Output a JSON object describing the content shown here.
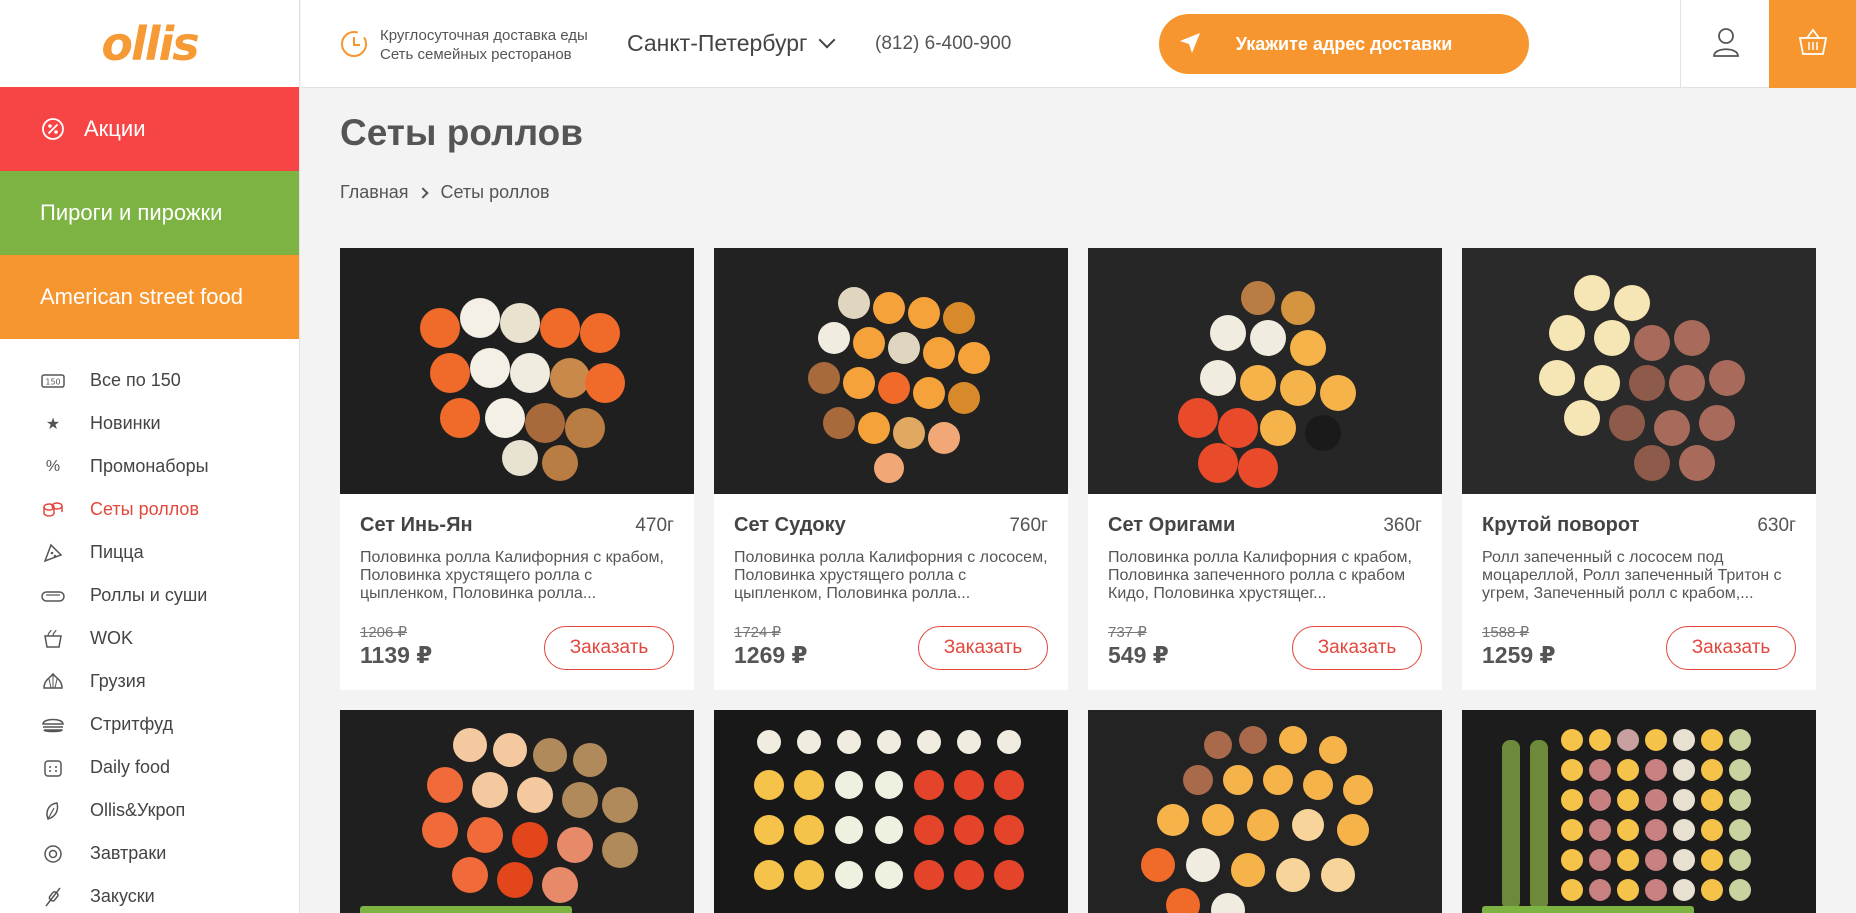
{
  "logo": "ollis",
  "promo_categories": [
    {
      "label": "Акции",
      "color": "#f74545",
      "icon": "percent-badge-icon"
    },
    {
      "label": "Пироги и пирожки",
      "color": "#7cb342"
    },
    {
      "label": "American street food",
      "color": "#f7962f"
    }
  ],
  "menu": [
    {
      "label": "Все по 150",
      "icon": "150-badge-icon",
      "active": false
    },
    {
      "label": "Новинки",
      "icon": "star-icon",
      "active": false
    },
    {
      "label": "Промонаборы",
      "icon": "percent-icon",
      "active": false
    },
    {
      "label": "Сеты роллов",
      "icon": "rolls-set-icon",
      "active": true
    },
    {
      "label": "Пицца",
      "icon": "pizza-icon",
      "active": false
    },
    {
      "label": "Роллы и суши",
      "icon": "sushi-icon",
      "active": false
    },
    {
      "label": "WOK",
      "icon": "wok-icon",
      "active": false
    },
    {
      "label": "Грузия",
      "icon": "khinkali-icon",
      "active": false
    },
    {
      "label": "Стритфуд",
      "icon": "burger-icon",
      "active": false
    },
    {
      "label": "Daily food",
      "icon": "calendar-icon",
      "active": false
    },
    {
      "label": "Ollis&Укроп",
      "icon": "leaf-icon",
      "active": false
    },
    {
      "label": "Завтраки",
      "icon": "egg-icon",
      "active": false
    },
    {
      "label": "Закуски",
      "icon": "skewer-icon",
      "active": false
    }
  ],
  "header": {
    "tagline_1": "Круглосуточная доставка еды",
    "tagline_2": "Сеть семейных ресторанов",
    "city": "Санкт-Петербург",
    "phone": "(812) 6-400-900",
    "address_button": "Укажите адрес доставки"
  },
  "page": {
    "title": "Сеты роллов",
    "breadcrumbs": [
      "Главная",
      "Сеты роллов"
    ]
  },
  "order_label": "Заказать",
  "products": [
    {
      "name": "Сет Инь-Ян",
      "weight": "470г",
      "desc": "Половинка ролла Калифорния с крабом, Половинка хрустящего ролла с цыпленком, Половинка ролла...",
      "old_price": "1206 ₽",
      "price": "1139 ₽"
    },
    {
      "name": "Сет Судоку",
      "weight": "760г",
      "desc": "Половинка ролла Калифорния с лососем, Половинка хрустящего ролла с цыпленком, Половинка ролла...",
      "old_price": "1724 ₽",
      "price": "1269 ₽"
    },
    {
      "name": "Сет Оригами",
      "weight": "360г",
      "desc": "Половинка ролла Калифорния с крабом, Половинка запеченного ролла с крабом Кидо, Половинка хрустящег...",
      "old_price": "737 ₽",
      "price": "549 ₽"
    },
    {
      "name": "Крутой поворот",
      "weight": "630г",
      "desc": "Ролл запеченный с лососем под моцареллой, Ролл запеченный Тритон с угрем, Запеченный ролл с крабом,...",
      "old_price": "1588 ₽",
      "price": "1259 ₽"
    }
  ],
  "colors": {
    "accent": "#f7962f",
    "red": "#e2483d",
    "green": "#7cb342"
  }
}
